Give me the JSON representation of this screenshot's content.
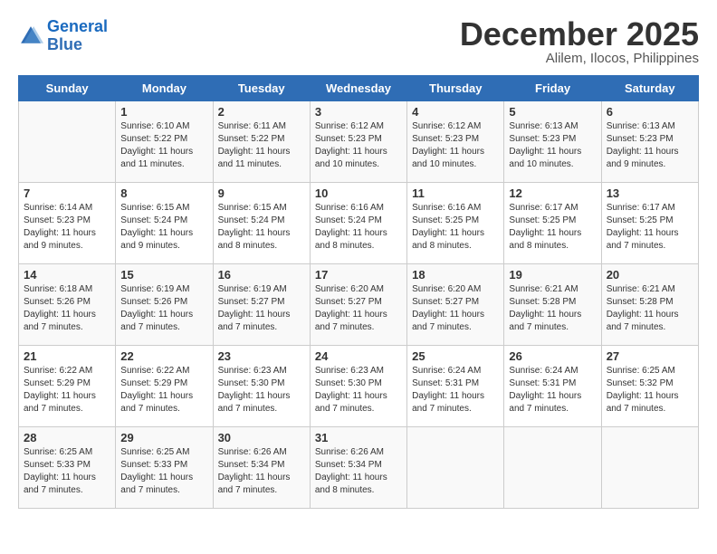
{
  "header": {
    "logo_line1": "General",
    "logo_line2": "Blue",
    "month": "December 2025",
    "location": "Alilem, Ilocos, Philippines"
  },
  "days_of_week": [
    "Sunday",
    "Monday",
    "Tuesday",
    "Wednesday",
    "Thursday",
    "Friday",
    "Saturday"
  ],
  "weeks": [
    [
      {
        "day": "",
        "sunrise": "",
        "sunset": "",
        "daylight": ""
      },
      {
        "day": "1",
        "sunrise": "Sunrise: 6:10 AM",
        "sunset": "Sunset: 5:22 PM",
        "daylight": "Daylight: 11 hours and 11 minutes."
      },
      {
        "day": "2",
        "sunrise": "Sunrise: 6:11 AM",
        "sunset": "Sunset: 5:22 PM",
        "daylight": "Daylight: 11 hours and 11 minutes."
      },
      {
        "day": "3",
        "sunrise": "Sunrise: 6:12 AM",
        "sunset": "Sunset: 5:23 PM",
        "daylight": "Daylight: 11 hours and 10 minutes."
      },
      {
        "day": "4",
        "sunrise": "Sunrise: 6:12 AM",
        "sunset": "Sunset: 5:23 PM",
        "daylight": "Daylight: 11 hours and 10 minutes."
      },
      {
        "day": "5",
        "sunrise": "Sunrise: 6:13 AM",
        "sunset": "Sunset: 5:23 PM",
        "daylight": "Daylight: 11 hours and 10 minutes."
      },
      {
        "day": "6",
        "sunrise": "Sunrise: 6:13 AM",
        "sunset": "Sunset: 5:23 PM",
        "daylight": "Daylight: 11 hours and 9 minutes."
      }
    ],
    [
      {
        "day": "7",
        "sunrise": "Sunrise: 6:14 AM",
        "sunset": "Sunset: 5:23 PM",
        "daylight": "Daylight: 11 hours and 9 minutes."
      },
      {
        "day": "8",
        "sunrise": "Sunrise: 6:15 AM",
        "sunset": "Sunset: 5:24 PM",
        "daylight": "Daylight: 11 hours and 9 minutes."
      },
      {
        "day": "9",
        "sunrise": "Sunrise: 6:15 AM",
        "sunset": "Sunset: 5:24 PM",
        "daylight": "Daylight: 11 hours and 8 minutes."
      },
      {
        "day": "10",
        "sunrise": "Sunrise: 6:16 AM",
        "sunset": "Sunset: 5:24 PM",
        "daylight": "Daylight: 11 hours and 8 minutes."
      },
      {
        "day": "11",
        "sunrise": "Sunrise: 6:16 AM",
        "sunset": "Sunset: 5:25 PM",
        "daylight": "Daylight: 11 hours and 8 minutes."
      },
      {
        "day": "12",
        "sunrise": "Sunrise: 6:17 AM",
        "sunset": "Sunset: 5:25 PM",
        "daylight": "Daylight: 11 hours and 8 minutes."
      },
      {
        "day": "13",
        "sunrise": "Sunrise: 6:17 AM",
        "sunset": "Sunset: 5:25 PM",
        "daylight": "Daylight: 11 hours and 7 minutes."
      }
    ],
    [
      {
        "day": "14",
        "sunrise": "Sunrise: 6:18 AM",
        "sunset": "Sunset: 5:26 PM",
        "daylight": "Daylight: 11 hours and 7 minutes."
      },
      {
        "day": "15",
        "sunrise": "Sunrise: 6:19 AM",
        "sunset": "Sunset: 5:26 PM",
        "daylight": "Daylight: 11 hours and 7 minutes."
      },
      {
        "day": "16",
        "sunrise": "Sunrise: 6:19 AM",
        "sunset": "Sunset: 5:27 PM",
        "daylight": "Daylight: 11 hours and 7 minutes."
      },
      {
        "day": "17",
        "sunrise": "Sunrise: 6:20 AM",
        "sunset": "Sunset: 5:27 PM",
        "daylight": "Daylight: 11 hours and 7 minutes."
      },
      {
        "day": "18",
        "sunrise": "Sunrise: 6:20 AM",
        "sunset": "Sunset: 5:27 PM",
        "daylight": "Daylight: 11 hours and 7 minutes."
      },
      {
        "day": "19",
        "sunrise": "Sunrise: 6:21 AM",
        "sunset": "Sunset: 5:28 PM",
        "daylight": "Daylight: 11 hours and 7 minutes."
      },
      {
        "day": "20",
        "sunrise": "Sunrise: 6:21 AM",
        "sunset": "Sunset: 5:28 PM",
        "daylight": "Daylight: 11 hours and 7 minutes."
      }
    ],
    [
      {
        "day": "21",
        "sunrise": "Sunrise: 6:22 AM",
        "sunset": "Sunset: 5:29 PM",
        "daylight": "Daylight: 11 hours and 7 minutes."
      },
      {
        "day": "22",
        "sunrise": "Sunrise: 6:22 AM",
        "sunset": "Sunset: 5:29 PM",
        "daylight": "Daylight: 11 hours and 7 minutes."
      },
      {
        "day": "23",
        "sunrise": "Sunrise: 6:23 AM",
        "sunset": "Sunset: 5:30 PM",
        "daylight": "Daylight: 11 hours and 7 minutes."
      },
      {
        "day": "24",
        "sunrise": "Sunrise: 6:23 AM",
        "sunset": "Sunset: 5:30 PM",
        "daylight": "Daylight: 11 hours and 7 minutes."
      },
      {
        "day": "25",
        "sunrise": "Sunrise: 6:24 AM",
        "sunset": "Sunset: 5:31 PM",
        "daylight": "Daylight: 11 hours and 7 minutes."
      },
      {
        "day": "26",
        "sunrise": "Sunrise: 6:24 AM",
        "sunset": "Sunset: 5:31 PM",
        "daylight": "Daylight: 11 hours and 7 minutes."
      },
      {
        "day": "27",
        "sunrise": "Sunrise: 6:25 AM",
        "sunset": "Sunset: 5:32 PM",
        "daylight": "Daylight: 11 hours and 7 minutes."
      }
    ],
    [
      {
        "day": "28",
        "sunrise": "Sunrise: 6:25 AM",
        "sunset": "Sunset: 5:33 PM",
        "daylight": "Daylight: 11 hours and 7 minutes."
      },
      {
        "day": "29",
        "sunrise": "Sunrise: 6:25 AM",
        "sunset": "Sunset: 5:33 PM",
        "daylight": "Daylight: 11 hours and 7 minutes."
      },
      {
        "day": "30",
        "sunrise": "Sunrise: 6:26 AM",
        "sunset": "Sunset: 5:34 PM",
        "daylight": "Daylight: 11 hours and 7 minutes."
      },
      {
        "day": "31",
        "sunrise": "Sunrise: 6:26 AM",
        "sunset": "Sunset: 5:34 PM",
        "daylight": "Daylight: 11 hours and 8 minutes."
      },
      {
        "day": "",
        "sunrise": "",
        "sunset": "",
        "daylight": ""
      },
      {
        "day": "",
        "sunrise": "",
        "sunset": "",
        "daylight": ""
      },
      {
        "day": "",
        "sunrise": "",
        "sunset": "",
        "daylight": ""
      }
    ]
  ]
}
